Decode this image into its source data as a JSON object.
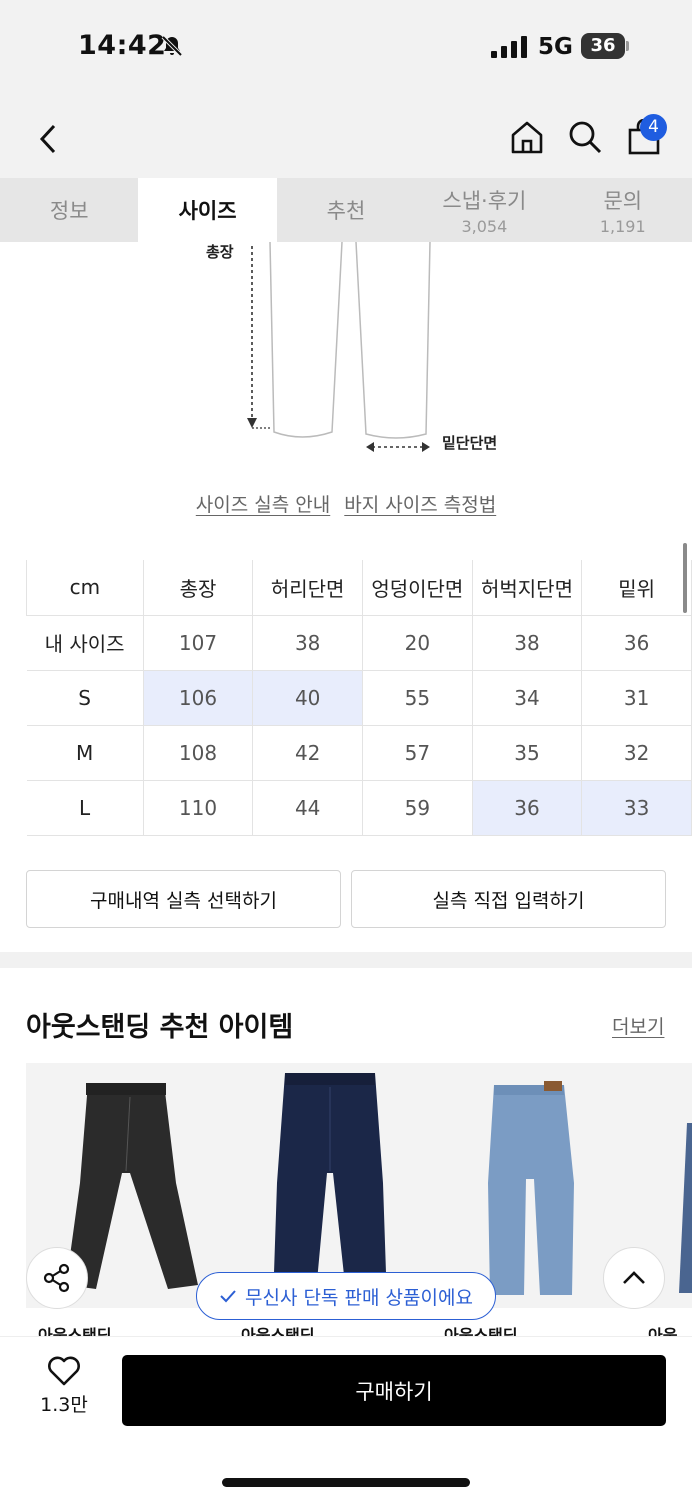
{
  "status_bar": {
    "time": "14:42",
    "network": "5G",
    "battery": "36"
  },
  "header": {
    "cart_count": "4"
  },
  "tabs": [
    {
      "label": "정보",
      "count": ""
    },
    {
      "label": "사이즈",
      "count": ""
    },
    {
      "label": "추천",
      "count": ""
    },
    {
      "label": "스냅·후기",
      "count": "3,054"
    },
    {
      "label": "문의",
      "count": "1,191"
    }
  ],
  "diagram": {
    "total_length_label": "총장",
    "hem_label": "밑단단면"
  },
  "guide_links": {
    "actual_size_guide": "사이즈 실측 안내",
    "pants_measure_guide": "바지 사이즈 측정법"
  },
  "size_table": {
    "headers": [
      "cm",
      "총장",
      "허리단면",
      "엉덩이단면",
      "허벅지단면",
      "밑위"
    ],
    "rows": [
      {
        "label": "내 사이즈",
        "values": [
          "107",
          "38",
          "20",
          "38",
          "36"
        ]
      },
      {
        "label": "S",
        "values": [
          "106",
          "40",
          "55",
          "34",
          "31"
        ]
      },
      {
        "label": "M",
        "values": [
          "108",
          "42",
          "57",
          "35",
          "32"
        ]
      },
      {
        "label": "L",
        "values": [
          "110",
          "44",
          "59",
          "36",
          "33"
        ]
      }
    ]
  },
  "actions": {
    "select_from_purchases": "구매내역 실측 선택하기",
    "direct_input": "실측 직접 입력하기"
  },
  "recommendations": {
    "title": "아웃스탠딩 추천 아이템",
    "more": "더보기",
    "items": [
      {
        "brand": "아웃스탠딩",
        "image": "black-carpenter-jeans"
      },
      {
        "brand": "아웃스탠딩",
        "image": "dark-indigo-jeans"
      },
      {
        "brand": "아웃스탠딩",
        "image": "light-blue-carpenter-jeans"
      },
      {
        "brand": "아웃스",
        "image": "blue-jeans"
      }
    ]
  },
  "exclusive_notice": "무신사 단독 판매 상품이에요",
  "bottom_bar": {
    "like_count": "1.3만",
    "buy_label": "구매하기"
  },
  "colors": {
    "accent": "#1f5de0",
    "highlight": "#e8edfc",
    "buy_button": "#000000"
  }
}
